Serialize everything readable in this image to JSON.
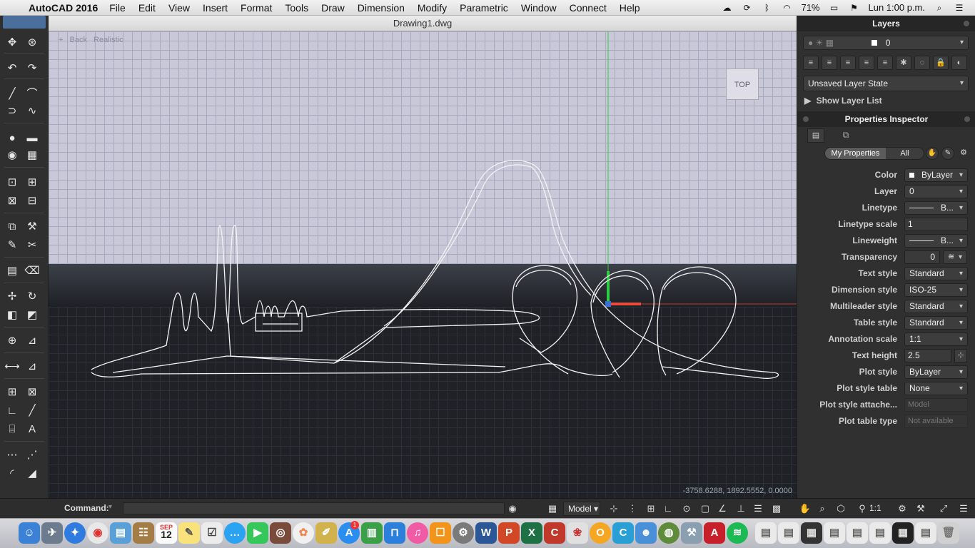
{
  "menubar": {
    "app_name": "AutoCAD 2016",
    "items": [
      "File",
      "Edit",
      "View",
      "Insert",
      "Format",
      "Tools",
      "Draw",
      "Dimension",
      "Modify",
      "Parametric",
      "Window",
      "Connect",
      "Help"
    ],
    "battery": "71%",
    "clock": "Lun 1:00 p.m."
  },
  "window": {
    "title": "Drawing1.dwg"
  },
  "viewport": {
    "view_controls": [
      "+",
      "Back",
      "Realistic"
    ],
    "viewcube_label": "TOP",
    "coordinates": "-3758.6288, 1892.5552, 0.0000"
  },
  "layers_panel": {
    "title": "Layers",
    "current_layer": "0",
    "layer_state": "Unsaved Layer State",
    "show_layer_list": "Show Layer List"
  },
  "properties_inspector": {
    "title": "Properties Inspector",
    "tabs": [
      "My Properties",
      "All"
    ],
    "rows": [
      {
        "label": "Color",
        "value": "ByLayer",
        "kind": "dropdown"
      },
      {
        "label": "Layer",
        "value": "0",
        "kind": "dropdown"
      },
      {
        "label": "Linetype",
        "value": "B...",
        "kind": "dropdown"
      },
      {
        "label": "Linetype scale",
        "value": "1",
        "kind": "plain"
      },
      {
        "label": "Lineweight",
        "value": "B...",
        "kind": "dropdown"
      },
      {
        "label": "Transparency",
        "value": "0",
        "kind": "plain"
      },
      {
        "label": "Text style",
        "value": "Standard",
        "kind": "dropdown"
      },
      {
        "label": "Dimension style",
        "value": "ISO-25",
        "kind": "dropdown"
      },
      {
        "label": "Multileader style",
        "value": "Standard",
        "kind": "dropdown"
      },
      {
        "label": "Table style",
        "value": "Standard",
        "kind": "dropdown"
      },
      {
        "label": "Annotation scale",
        "value": "1:1",
        "kind": "dropdown"
      },
      {
        "label": "Text height",
        "value": "2.5",
        "kind": "plain"
      },
      {
        "label": "Plot style",
        "value": "ByLayer",
        "kind": "dropdown"
      },
      {
        "label": "Plot style table",
        "value": "None",
        "kind": "dropdown"
      },
      {
        "label": "Plot style attache...",
        "value": "Model",
        "kind": "disabled"
      },
      {
        "label": "Plot table type",
        "value": "Not available",
        "kind": "disabled"
      }
    ]
  },
  "command_bar": {
    "label": "Command:",
    "model_label": "Model",
    "annotation_scale": "1:1"
  },
  "dock": {
    "calendar_month": "SEP",
    "calendar_day": "12",
    "badge": "1"
  }
}
